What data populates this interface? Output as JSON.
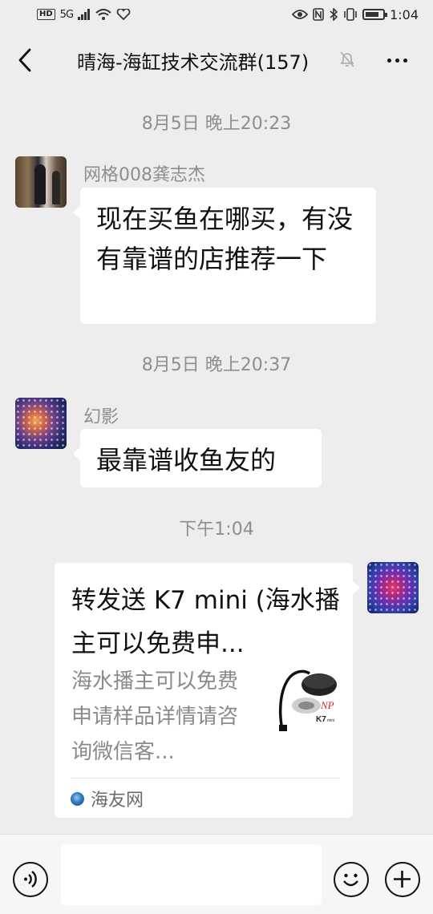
{
  "status_bar": {
    "hd": "HD",
    "signal": "5G",
    "time": "1:04"
  },
  "header": {
    "title": "晴海-海缸技术交流群(157)"
  },
  "messages": [
    {
      "type": "timestamp",
      "text": "8月5日 晚上20:23"
    },
    {
      "type": "text",
      "sender": "网格008龚志杰",
      "text": "现在买鱼在哪买，有没有靠谱的店推荐一下"
    },
    {
      "type": "timestamp",
      "text": "8月5日 晚上20:37"
    },
    {
      "type": "text",
      "sender": "幻影",
      "text": "最靠谱收鱼友的"
    },
    {
      "type": "timestamp",
      "text": "下午1:04"
    },
    {
      "type": "link_card",
      "title": "转发送 K7 mini (海水播主可以免费申...",
      "description": "海水播主可以免费申请样品详情请咨询微信客...",
      "source": "海友网",
      "thumb_brand": "NP",
      "thumb_model": "K7",
      "thumb_sub": "mini"
    }
  ],
  "input": {
    "placeholder": "",
    "value": ""
  }
}
